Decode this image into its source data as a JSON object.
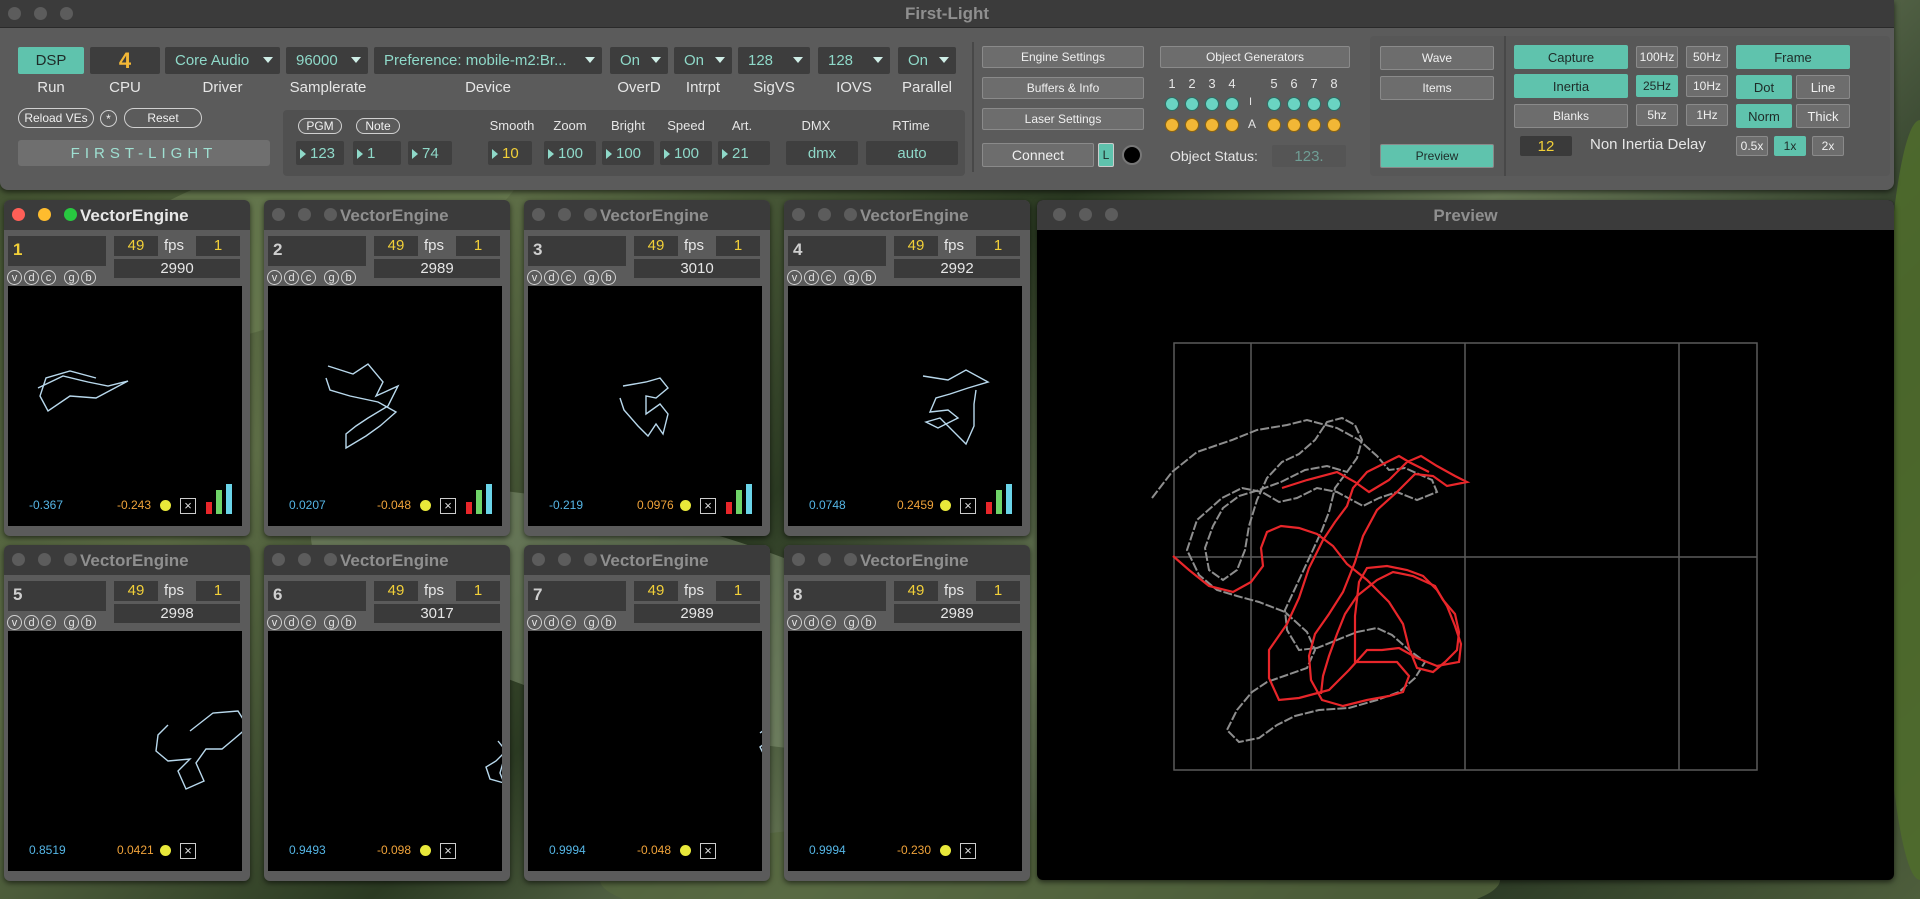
{
  "app": {
    "title": "First-Light"
  },
  "toolbar": {
    "dsp_label": "DSP",
    "run_label": "Run",
    "cpu_value": "4",
    "cpu_label": "CPU",
    "driver_value": "Core Audio",
    "driver_label": "Driver",
    "samplerate_value": "96000",
    "samplerate_label": "Samplerate",
    "device_value": "Preference: mobile-m2:Br...",
    "device_label": "Device",
    "overd_value": "On",
    "overd_label": "OverD",
    "intrpt_value": "On",
    "intrpt_label": "Intrpt",
    "sigvs_value": "128",
    "sigvs_label": "SigVS",
    "iovs_value": "128",
    "iovs_label": "IOVS",
    "parallel_value": "On",
    "parallel_label": "Parallel",
    "reload_label": "Reload VEs",
    "star_label": "*",
    "reset_label": "Reset",
    "brand_label": "FIRST-LIGHT",
    "pgm_label": "PGM",
    "note_label": "Note",
    "pgm_values": [
      "123",
      "1",
      "74"
    ],
    "smooth_label": "Smooth",
    "smooth_value": "10",
    "zoom_label": "Zoom",
    "zoom_value": "100",
    "bright_label": "Bright",
    "bright_value": "100",
    "speed_label": "Speed",
    "speed_value": "100",
    "art_label": "Art.",
    "art_value": "21",
    "dmx_label": "DMX",
    "dmx_value": "dmx",
    "rtime_label": "RTime",
    "rtime_value": "auto"
  },
  "settings": {
    "engine_settings": "Engine Settings",
    "buffers_info": "Buffers & Info",
    "laser_settings": "Laser Settings",
    "connect": "Connect",
    "l_label": "L"
  },
  "generators": {
    "title": "Object Generators",
    "numbers": [
      "1",
      "2",
      "3",
      "4",
      "5",
      "6",
      "7",
      "8"
    ],
    "i_label": "I",
    "a_label": "A",
    "status_label": "Object Status:",
    "status_value": "123."
  },
  "modes": {
    "wave": "Wave",
    "items": "Items",
    "preview": "Preview",
    "capture": "Capture",
    "inertia": "Inertia",
    "blanks": "Blanks",
    "rates": [
      "100Hz",
      "50Hz",
      "25Hz",
      "10Hz",
      "5hz",
      "1Hz"
    ],
    "frame": "Frame",
    "dot": "Dot",
    "line": "Line",
    "norm": "Norm",
    "thick": "Thick",
    "delay_value": "12",
    "delay_label": "Non Inertia Delay",
    "speeds": [
      "0.5x",
      "1x",
      "2x"
    ]
  },
  "engines": [
    {
      "title": "VectorEngine",
      "index": "1",
      "fps": "49",
      "fps_label": "fps",
      "one": "1",
      "count": "2990",
      "vx": "-0.367",
      "vy": "-0.243"
    },
    {
      "title": "VectorEngine",
      "index": "2",
      "fps": "49",
      "fps_label": "fps",
      "one": "1",
      "count": "2989",
      "vx": "0.0207",
      "vy": "-0.048"
    },
    {
      "title": "VectorEngine",
      "index": "3",
      "fps": "49",
      "fps_label": "fps",
      "one": "1",
      "count": "3010",
      "vx": "-0.219",
      "vy": "0.0976"
    },
    {
      "title": "VectorEngine",
      "index": "4",
      "fps": "49",
      "fps_label": "fps",
      "one": "1",
      "count": "2992",
      "vx": "0.0748",
      "vy": "0.2459"
    },
    {
      "title": "VectorEngine",
      "index": "5",
      "fps": "49",
      "fps_label": "fps",
      "one": "1",
      "count": "2998",
      "vx": "0.8519",
      "vy": "0.0421"
    },
    {
      "title": "VectorEngine",
      "index": "6",
      "fps": "49",
      "fps_label": "fps",
      "one": "1",
      "count": "3017",
      "vx": "0.9493",
      "vy": "-0.098"
    },
    {
      "title": "VectorEngine",
      "index": "7",
      "fps": "49",
      "fps_label": "fps",
      "one": "1",
      "count": "2989",
      "vx": "0.9994",
      "vy": "-0.048"
    },
    {
      "title": "VectorEngine",
      "index": "8",
      "fps": "49",
      "fps_label": "fps",
      "one": "1",
      "count": "2989",
      "vx": "0.9994",
      "vy": "-0.230"
    }
  ],
  "engine_letters": [
    "v",
    "d",
    "c",
    "g",
    "b"
  ],
  "preview": {
    "title": "Preview"
  },
  "colors": {
    "teal": "#5fc3ad",
    "yellow": "#f2d038",
    "red": "#e8262a",
    "preview_line": "#c8c8c8"
  }
}
